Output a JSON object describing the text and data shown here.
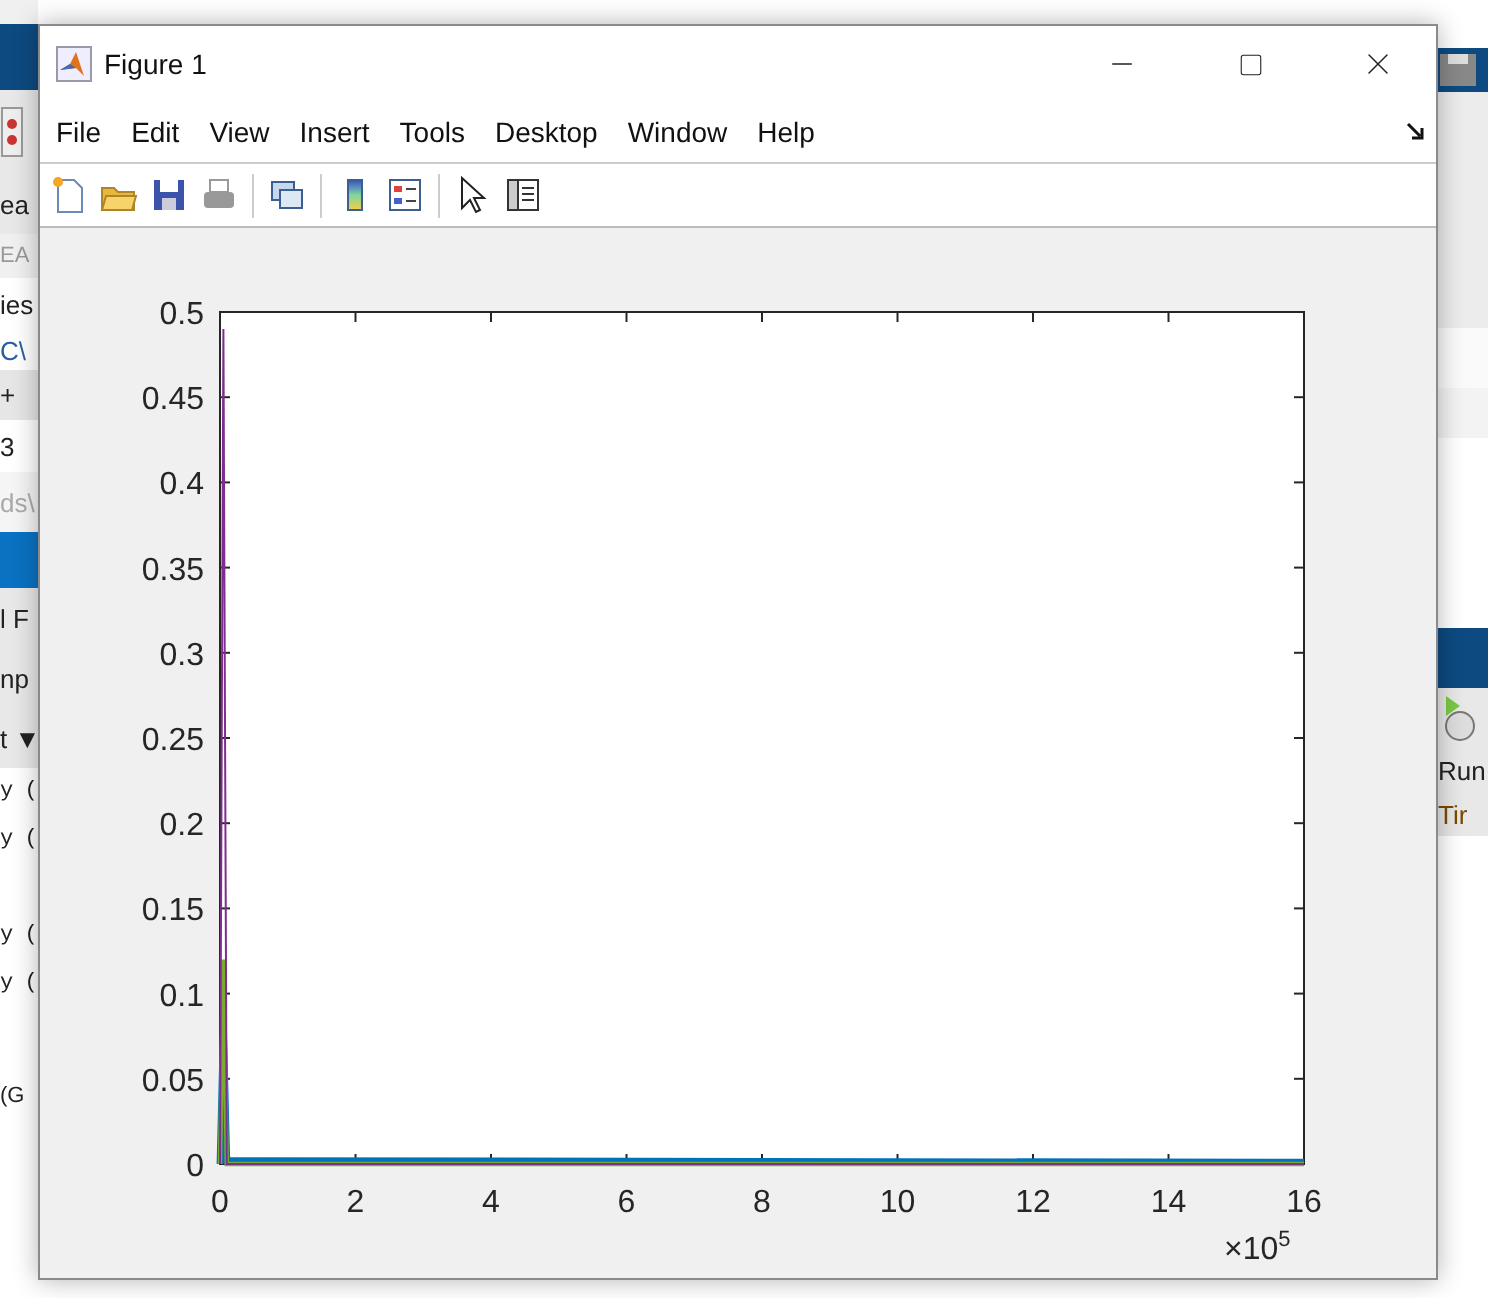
{
  "desktop": {
    "left_fragments": [
      {
        "kind": "ribbon",
        "text": "ea"
      },
      {
        "kind": "section",
        "text": "EA"
      },
      {
        "kind": "field",
        "text": "ies"
      },
      {
        "kind": "path",
        "text": "C\\"
      },
      {
        "kind": "tab",
        "text": "+"
      },
      {
        "kind": "field",
        "text": "3"
      },
      {
        "kind": "hint",
        "text": "ds\\"
      },
      {
        "kind": "band"
      },
      {
        "kind": "ribbon",
        "text": "l F"
      },
      {
        "kind": "ribbon",
        "text": "np"
      },
      {
        "kind": "dropdown",
        "text": "t ▼"
      },
      {
        "kind": "console",
        "text": "y ("
      },
      {
        "kind": "console",
        "text": "y ("
      },
      {
        "kind": "gap"
      },
      {
        "kind": "console",
        "text": "y ("
      },
      {
        "kind": "console",
        "text": "y ("
      },
      {
        "kind": "gap"
      },
      {
        "kind": "console-small",
        "text": "(G"
      }
    ],
    "right_fragments": [
      "Run",
      "Tir"
    ]
  },
  "window": {
    "title": "Figure 1",
    "menu": [
      "File",
      "Edit",
      "View",
      "Insert",
      "Tools",
      "Desktop",
      "Window",
      "Help"
    ],
    "chart_data": {
      "type": "line",
      "x": [
        0,
        0.05,
        0.1,
        16
      ],
      "series": [
        {
          "color": "#0072bd",
          "values": [
            0,
            0.08,
            0.002,
            0.001
          ]
        },
        {
          "color": "#77ac30",
          "values": [
            0,
            0.12,
            0,
            0
          ]
        },
        {
          "color": "#7e2f8e",
          "values": [
            0,
            0.49,
            0,
            0
          ]
        }
      ],
      "xlim": [
        0,
        16
      ],
      "ylim": [
        0,
        0.5
      ],
      "xticks": [
        0,
        2,
        4,
        6,
        8,
        10,
        12,
        14,
        16
      ],
      "yticks": [
        0,
        {
          "value": 0.05,
          "label": "0.05"
        },
        {
          "value": 0.1,
          "label": "0.1"
        },
        {
          "value": 0.15,
          "label": "0.15"
        },
        {
          "value": 0.2,
          "label": "0.2"
        },
        {
          "value": 0.25,
          "label": "0.25"
        },
        {
          "value": 0.3,
          "label": "0.3"
        },
        {
          "value": 0.35,
          "label": "0.35"
        },
        {
          "value": 0.4,
          "label": "0.4"
        },
        {
          "value": 0.45,
          "label": "0.45"
        },
        {
          "value": 0.5,
          "label": "0.5"
        }
      ],
      "annotations": [
        "×10$^{5}$"
      ]
    }
  }
}
